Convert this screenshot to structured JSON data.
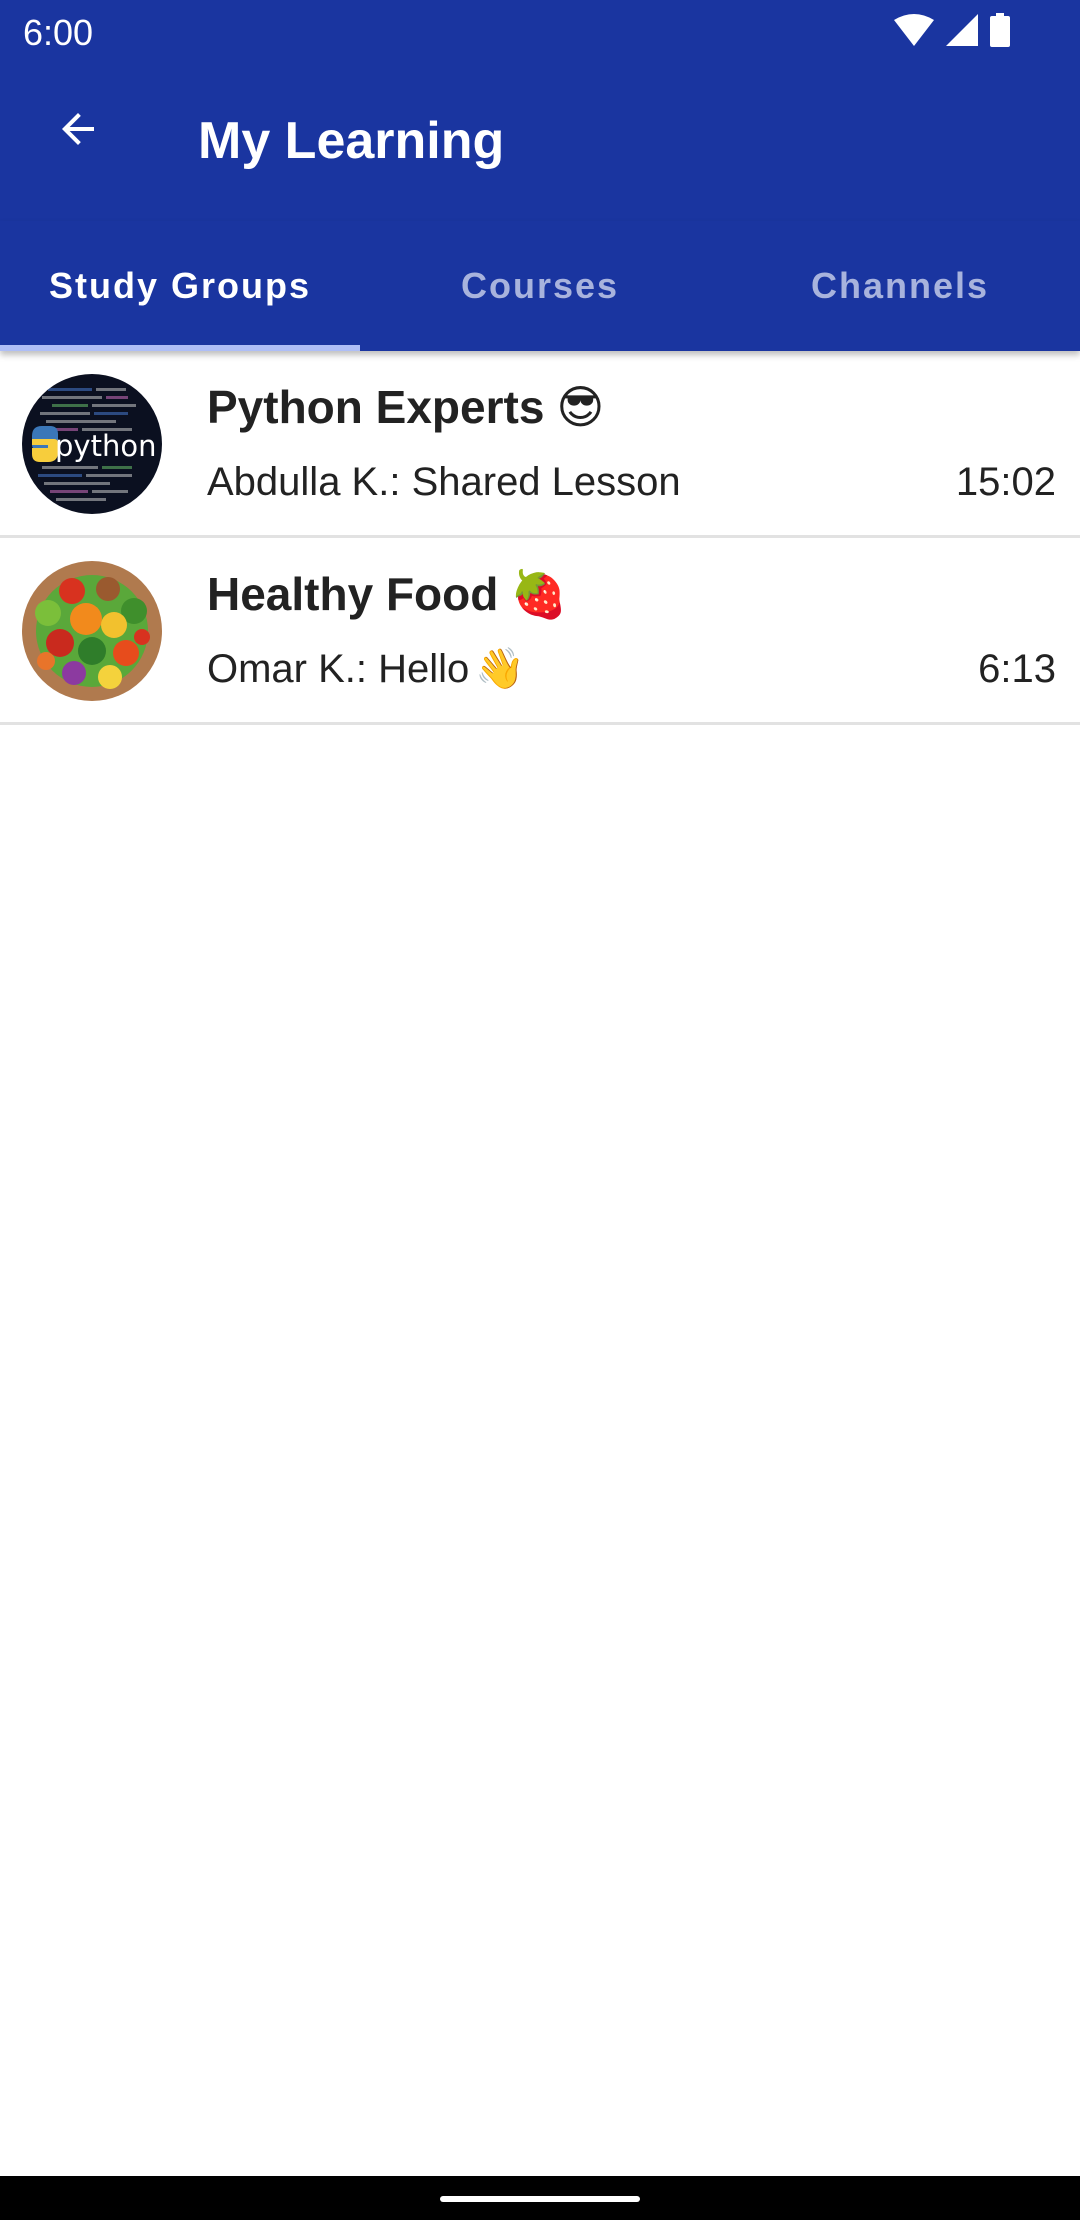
{
  "status_bar": {
    "time": "6:00",
    "icons": [
      "wifi-icon",
      "cellular-signal-icon",
      "battery-icon"
    ]
  },
  "app_bar": {
    "title": "My Learning",
    "back_icon": "arrow-back-icon"
  },
  "tabs": [
    {
      "label": "Study Groups",
      "active": true
    },
    {
      "label": "Courses",
      "active": false
    },
    {
      "label": "Channels",
      "active": false
    }
  ],
  "groups": [
    {
      "name": "Python Experts",
      "name_emoji": "😎",
      "last_message": "Abdulla K.: Shared Lesson",
      "message_emoji": "",
      "time": "15:02",
      "avatar_icon": "python-logo-avatar",
      "avatar_text": "python"
    },
    {
      "name": "Healthy Food",
      "name_emoji": "🍓",
      "last_message": "Omar K.: Hello",
      "message_emoji": "👋",
      "time": "6:13",
      "avatar_icon": "vegetables-avatar"
    }
  ],
  "colors": {
    "primary": "#1a35a0",
    "tab_inactive": "#a8b3dd",
    "tab_indicator": "#aebef7",
    "divider": "#e2e2e2",
    "text": "#222222"
  }
}
